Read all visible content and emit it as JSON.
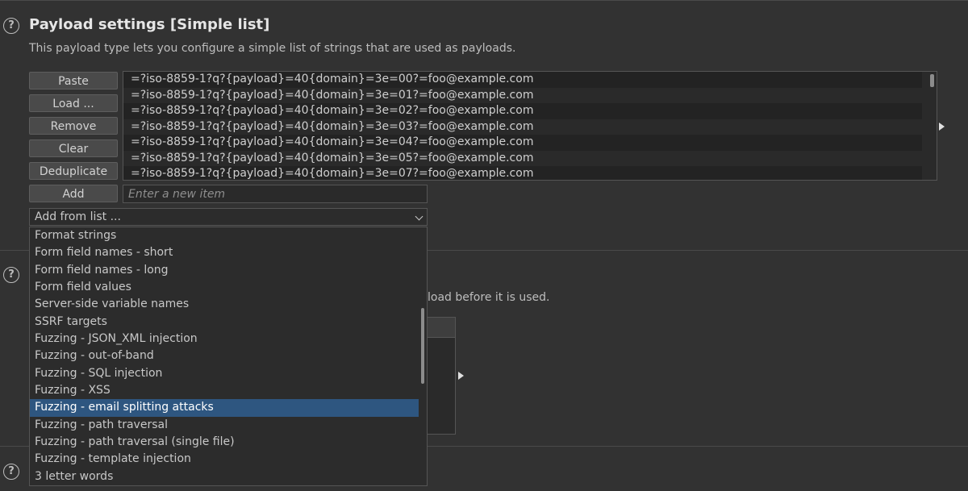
{
  "section": {
    "title": "Payload settings [Simple list]",
    "description": "This payload type lets you configure a simple list of strings that are used as payloads."
  },
  "buttons": {
    "paste": "Paste",
    "load": "Load ...",
    "remove": "Remove",
    "clear": "Clear",
    "deduplicate": "Deduplicate",
    "add": "Add"
  },
  "payloads": [
    "=?iso-8859-1?q?{payload}=40{domain}=3e=00?=foo@example.com",
    "=?iso-8859-1?q?{payload}=40{domain}=3e=01?=foo@example.com",
    "=?iso-8859-1?q?{payload}=40{domain}=3e=02?=foo@example.com",
    "=?iso-8859-1?q?{payload}=40{domain}=3e=03?=foo@example.com",
    "=?iso-8859-1?q?{payload}=40{domain}=3e=04?=foo@example.com",
    "=?iso-8859-1?q?{payload}=40{domain}=3e=05?=foo@example.com",
    "=?iso-8859-1?q?{payload}=40{domain}=3e=07?=foo@example.com"
  ],
  "new_item": {
    "placeholder": "Enter a new item"
  },
  "add_from_list": {
    "selected": "Add from list ...",
    "options": [
      "Format strings",
      "Form field names - short",
      "Form field names - long",
      "Form field values",
      "Server-side variable names",
      "SSRF targets",
      "Fuzzing - JSON_XML injection",
      "Fuzzing - out-of-band",
      "Fuzzing - SQL injection",
      "Fuzzing - XSS",
      "Fuzzing - email splitting attacks",
      "Fuzzing - path traversal",
      "Fuzzing - path traversal (single file)",
      "Fuzzing - template injection",
      "3 letter words"
    ],
    "highlighted": "Fuzzing - email splitting attacks"
  },
  "background": {
    "processing_text_fragment": "load before it is used."
  },
  "icons": {
    "help": "question-circle-icon",
    "expand": "triangle-right-icon",
    "dropdown": "chevron-down-icon"
  },
  "colors": {
    "background": "#323232",
    "selection": "#2e5680",
    "button": "#4a4a4a"
  }
}
